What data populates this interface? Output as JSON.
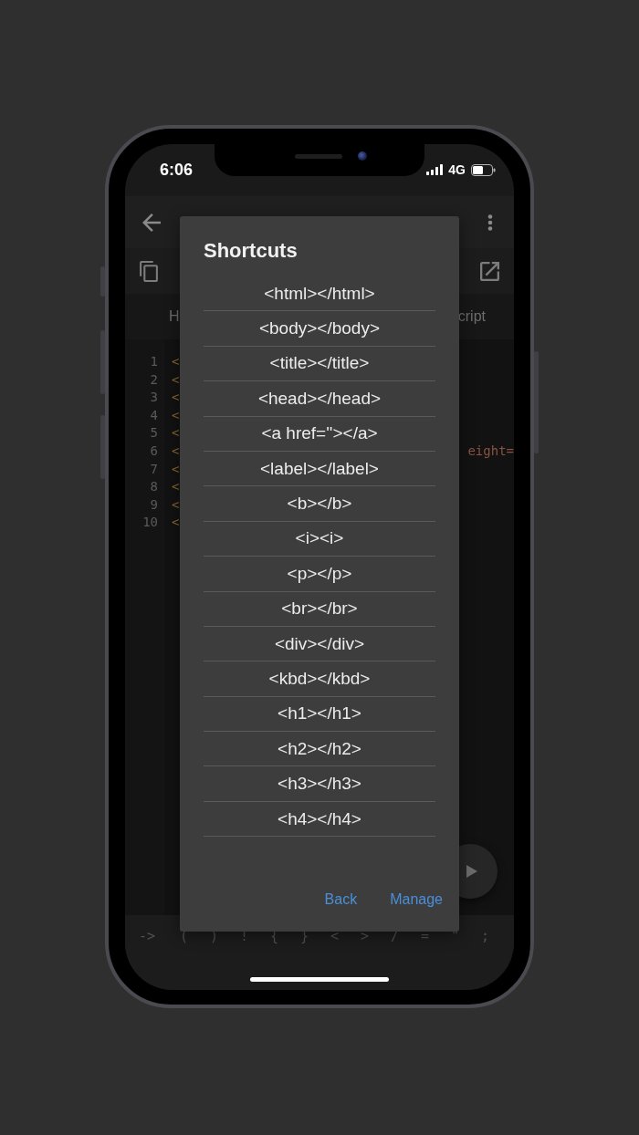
{
  "status_bar": {
    "time": "6:06",
    "network": "4G"
  },
  "tabs": [
    {
      "label": "H"
    },
    {
      "label": "cript"
    }
  ],
  "code_lines": [
    {
      "number": "1",
      "tokens": [
        {
          "text": "<",
          "kind": "tag"
        }
      ]
    },
    {
      "number": "2",
      "tokens": [
        {
          "text": "<",
          "kind": "tag"
        }
      ]
    },
    {
      "number": "3",
      "tokens": [
        {
          "text": "<",
          "kind": "tag"
        }
      ]
    },
    {
      "number": "4",
      "tokens": [
        {
          "text": "<",
          "kind": "tag"
        }
      ]
    },
    {
      "number": "5",
      "tokens": [
        {
          "text": "<",
          "kind": "tag"
        }
      ]
    },
    {
      "number": "6",
      "tokens": [
        {
          "text": "<",
          "kind": "tag"
        },
        {
          "text": "eight=",
          "kind": "attribute"
        }
      ]
    },
    {
      "number": "7",
      "tokens": [
        {
          "text": "<",
          "kind": "tag"
        }
      ]
    },
    {
      "number": "8",
      "tokens": [
        {
          "text": "<",
          "kind": "tag"
        }
      ]
    },
    {
      "number": "9",
      "tokens": [
        {
          "text": "<",
          "kind": "tag"
        }
      ]
    },
    {
      "number": "10",
      "tokens": [
        {
          "text": "<",
          "kind": "tag"
        }
      ]
    }
  ],
  "symbol_keys": [
    "->",
    "(",
    ")",
    "!",
    "{",
    "}",
    "<",
    ">",
    "/",
    "=",
    "\"",
    ";"
  ],
  "dialog": {
    "title": "Shortcuts",
    "items": [
      "<html></html>",
      "<body></body>",
      "<title></title>",
      "<head></head>",
      "<a href=''></a>",
      "<label></label>",
      "<b></b>",
      "<i><i>",
      "<p></p>",
      "<br></br>",
      "<div></div>",
      "<kbd></kbd>",
      "<h1></h1>",
      "<h2></h2>",
      "<h3></h3>",
      "<h4></h4>"
    ],
    "actions": [
      "Back",
      "Manage"
    ]
  }
}
